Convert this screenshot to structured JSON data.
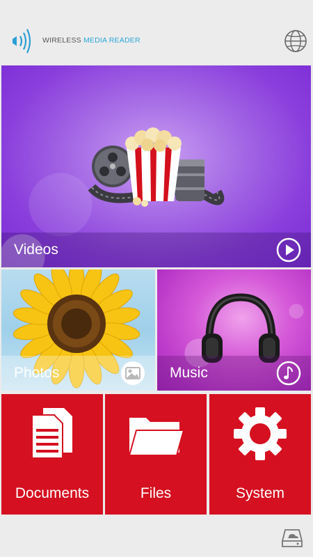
{
  "header": {
    "title_part1": "WIRELESS ",
    "title_part2": "MEDIA READER",
    "left_icon": "wifi-signal-icon",
    "right_icon": "globe-icon"
  },
  "tiles": {
    "videos": {
      "label": "Videos",
      "icon": "play-icon"
    },
    "photos": {
      "label": "Photos",
      "icon": "image-icon"
    },
    "music": {
      "label": "Music",
      "icon": "music-note-icon"
    },
    "documents": {
      "label": "Documents",
      "icon": "documents-icon"
    },
    "files": {
      "label": "Files",
      "icon": "folder-icon"
    },
    "system": {
      "label": "System",
      "icon": "gear-icon"
    }
  },
  "footer": {
    "icon": "cloud-drive-icon"
  },
  "colors": {
    "accent": "#29a6d8",
    "red_tile": "#d51020",
    "background": "#ebebeb"
  }
}
